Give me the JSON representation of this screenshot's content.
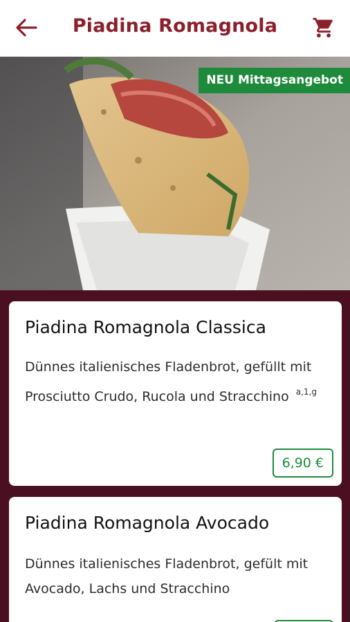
{
  "header": {
    "title": "Piadina Romagnola",
    "back_icon": "arrow-left-icon",
    "cart_icon": "shopping-cart-icon",
    "accent_color": "#8c1f2b"
  },
  "hero": {
    "badge": "NEU Mittagsangebot",
    "badge_color": "#1e8a3b"
  },
  "products": [
    {
      "name": "Piadina Romagnola Classica",
      "description": "Dünnes italienisches Fladenbrot, gefüllt mit Prosciutto Crudo, Rucola und Stracchino",
      "allergens": "a,1,g",
      "price": "6,90 €"
    },
    {
      "name": "Piadina Romagnola Avocado",
      "description": "Dünnes italienisches Fladenbrot, gefült mit Avocado, Lachs und Stracchino",
      "allergens": "",
      "price": ""
    }
  ],
  "colors": {
    "background": "#4a0f20",
    "price_green": "#1e8a3b"
  }
}
